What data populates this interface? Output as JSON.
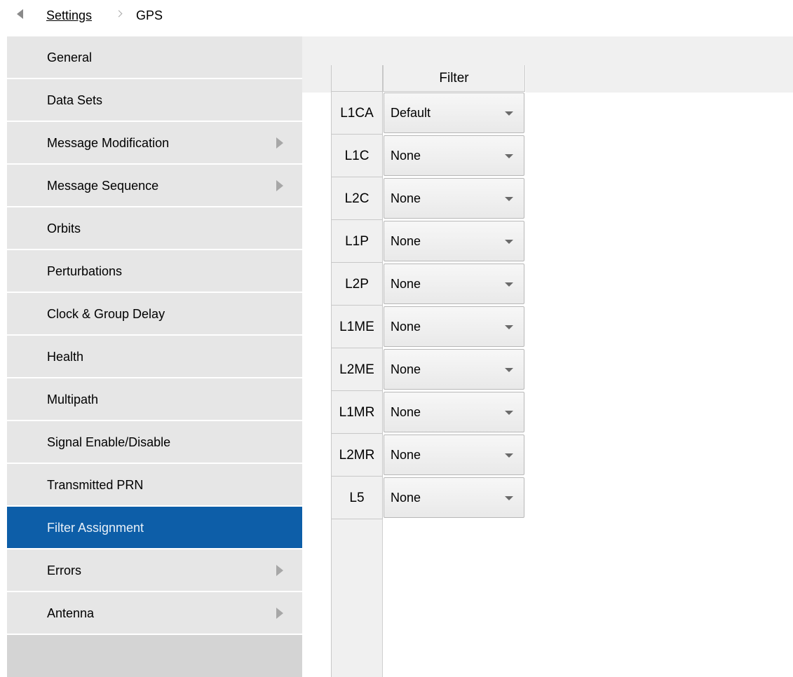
{
  "breadcrumb": {
    "parent": "Settings",
    "current": "GPS"
  },
  "sidebar": {
    "items": [
      {
        "label": "General",
        "has_submenu": false,
        "active": false
      },
      {
        "label": "Data Sets",
        "has_submenu": false,
        "active": false
      },
      {
        "label": "Message Modification",
        "has_submenu": true,
        "active": false
      },
      {
        "label": "Message Sequence",
        "has_submenu": true,
        "active": false
      },
      {
        "label": "Orbits",
        "has_submenu": false,
        "active": false
      },
      {
        "label": "Perturbations",
        "has_submenu": false,
        "active": false
      },
      {
        "label": "Clock & Group Delay",
        "has_submenu": false,
        "active": false
      },
      {
        "label": "Health",
        "has_submenu": false,
        "active": false
      },
      {
        "label": "Multipath",
        "has_submenu": false,
        "active": false
      },
      {
        "label": "Signal Enable/Disable",
        "has_submenu": false,
        "active": false
      },
      {
        "label": "Transmitted PRN",
        "has_submenu": false,
        "active": false
      },
      {
        "label": "Filter Assignment",
        "has_submenu": false,
        "active": true
      },
      {
        "label": "Errors",
        "has_submenu": true,
        "active": false
      },
      {
        "label": "Antenna",
        "has_submenu": true,
        "active": false
      }
    ]
  },
  "table": {
    "column_header": "Filter",
    "rows": [
      {
        "signal": "L1CA",
        "filter": "Default"
      },
      {
        "signal": "L1C",
        "filter": "None"
      },
      {
        "signal": "L2C",
        "filter": "None"
      },
      {
        "signal": "L1P",
        "filter": "None"
      },
      {
        "signal": "L2P",
        "filter": "None"
      },
      {
        "signal": "L1ME",
        "filter": "None"
      },
      {
        "signal": "L2ME",
        "filter": "None"
      },
      {
        "signal": "L1MR",
        "filter": "None"
      },
      {
        "signal": "L2MR",
        "filter": "None"
      },
      {
        "signal": "L5",
        "filter": "None"
      }
    ]
  },
  "colors": {
    "active_item": "#0d5ea8",
    "sidebar_item": "#e6e6e6",
    "sidebar_bg": "#d4d4d4"
  },
  "icons": {
    "back": "back-triangle-icon",
    "separator": "chevron-right-icon",
    "submenu": "submenu-arrow-icon",
    "dropdown": "caret-down-icon"
  }
}
